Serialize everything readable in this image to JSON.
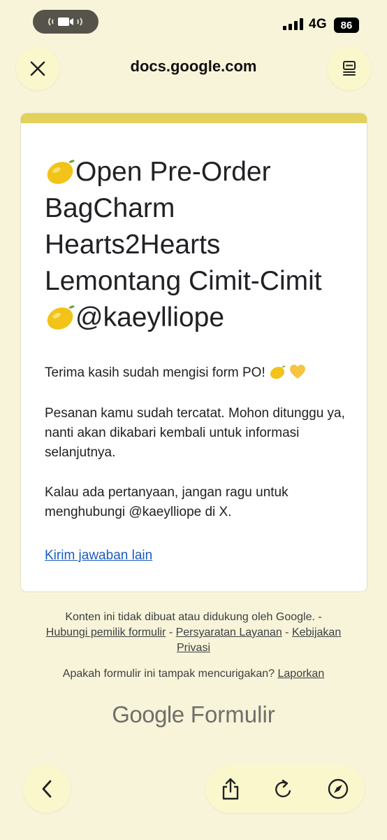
{
  "status_bar": {
    "network": "4G",
    "battery": "86"
  },
  "browser": {
    "url": "docs.google.com"
  },
  "form": {
    "title_parts": [
      "Open Pre-Order BagCharm Hearts2Hearts Lemontang Cimit-Cimit",
      "@kaeylliope"
    ],
    "thank_you": "Terima kasih sudah mengisi form PO!",
    "recorded": "Pesanan kamu sudah tercatat. Mohon ditunggu ya, nanti akan dikabari kembali untuk informasi selanjutnya.",
    "questions": "Kalau ada pertanyaan, jangan ragu untuk menghubungi @kaeylliope di X.",
    "another_response_link": "Kirim jawaban lain",
    "accent_color": "#e2d15a"
  },
  "footer": {
    "disclaimer": "Konten ini tidak dibuat atau didukung oleh Google. -",
    "contact_link": "Hubungi pemilik formulir",
    "sep1": " - ",
    "terms_link": "Persyaratan Layanan",
    "sep2": " - ",
    "privacy_link": "Kebijakan Privasi",
    "suspicious": "Apakah formulir ini tampak mencurigakan?",
    "report_link": "Laporkan",
    "brand_google": "Google",
    "brand_product": "Formulir"
  },
  "icons": {
    "close": "close-icon",
    "reader": "reader-icon",
    "back": "chevron-left-icon",
    "share": "share-icon",
    "reload": "reload-icon",
    "compass": "compass-icon",
    "lemon": "lemon-emoji",
    "heart": "yellow-heart-emoji"
  }
}
